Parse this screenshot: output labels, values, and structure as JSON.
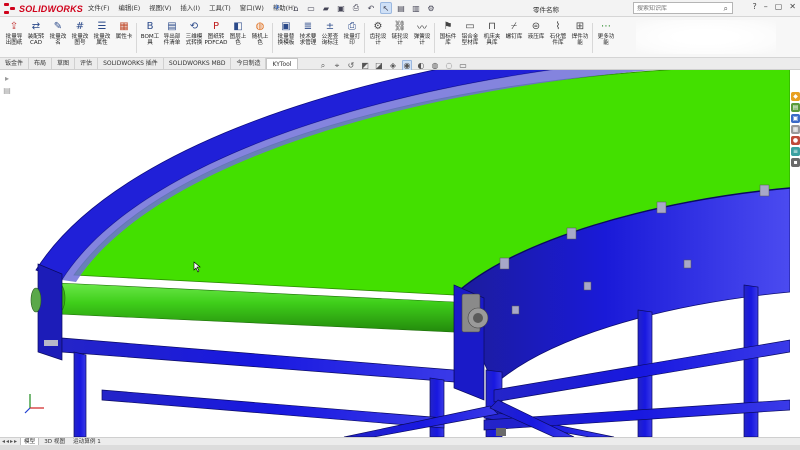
{
  "app": {
    "logo_text": "SOLIDWORKS",
    "document_title": "零件名称"
  },
  "menu": [
    "文件(F)",
    "编辑(E)",
    "视图(V)",
    "插入(I)",
    "工具(T)",
    "窗口(W)",
    "帮助(H)"
  ],
  "search": {
    "placeholder": "搜索知识库"
  },
  "ribbon": [
    {
      "label": "批量导\n出图纸",
      "icon": "export-icon"
    },
    {
      "label": "装配转\nCAD",
      "icon": "assembly-icon"
    },
    {
      "label": "批量改\n名",
      "icon": "rename-icon"
    },
    {
      "label": "批量改\n图号",
      "icon": "number-icon"
    },
    {
      "label": "批量改\n属性",
      "icon": "property-icon"
    },
    {
      "label": "属性卡",
      "icon": "card-icon"
    },
    {
      "label": "BOM工\n具",
      "icon": "bom-icon"
    },
    {
      "label": "导出部\n件清单",
      "icon": "list-icon"
    },
    {
      "label": "三维模\n式转换",
      "icon": "convert-icon"
    },
    {
      "label": "图纸转\nPDFCAD",
      "icon": "pdf-icon"
    },
    {
      "label": "图层上\n色",
      "icon": "layer-icon"
    },
    {
      "label": "随机上\n色",
      "icon": "color-icon"
    },
    {
      "label": "批量替\n换模板",
      "icon": "template-icon"
    },
    {
      "label": "技术要\n求管理",
      "icon": "requirement-icon"
    },
    {
      "label": "公差查\n询标注",
      "icon": "tolerance-icon"
    },
    {
      "label": "批量打\n印",
      "icon": "print-icon"
    },
    {
      "label": "齿轮设\n计",
      "icon": "gear-icon"
    },
    {
      "label": "链轮设\n计",
      "icon": "sprocket-icon"
    },
    {
      "label": "弹簧设\n计",
      "icon": "spring-icon"
    },
    {
      "label": "国标件\n库",
      "icon": "standard-parts-icon"
    },
    {
      "label": "铝合金\n型材库",
      "icon": "profile-icon"
    },
    {
      "label": "机床夹\n具库",
      "icon": "fixture-icon"
    },
    {
      "label": "螺钉库",
      "icon": "screw-icon"
    },
    {
      "label": "液压库",
      "icon": "hydraulic-icon"
    },
    {
      "label": "石化管\n件库",
      "icon": "pipe-icon"
    },
    {
      "label": "焊件功\n能",
      "icon": "weld-icon"
    },
    {
      "label": "更多功\n能",
      "icon": "more-icon"
    }
  ],
  "tabs": [
    "钣金件",
    "布局",
    "草图",
    "评估",
    "SOLIDWORKS 插件",
    "SOLIDWORKS MBD",
    "今日制造",
    "KYTool"
  ],
  "bottom_tabs": [
    "模型",
    "3D 视图",
    "运动算例 1"
  ],
  "colors": {
    "belt": "#43e000",
    "frame": "#1a1ad6",
    "roller": "#3fcf1a",
    "bearing": "#7a7a7a"
  }
}
